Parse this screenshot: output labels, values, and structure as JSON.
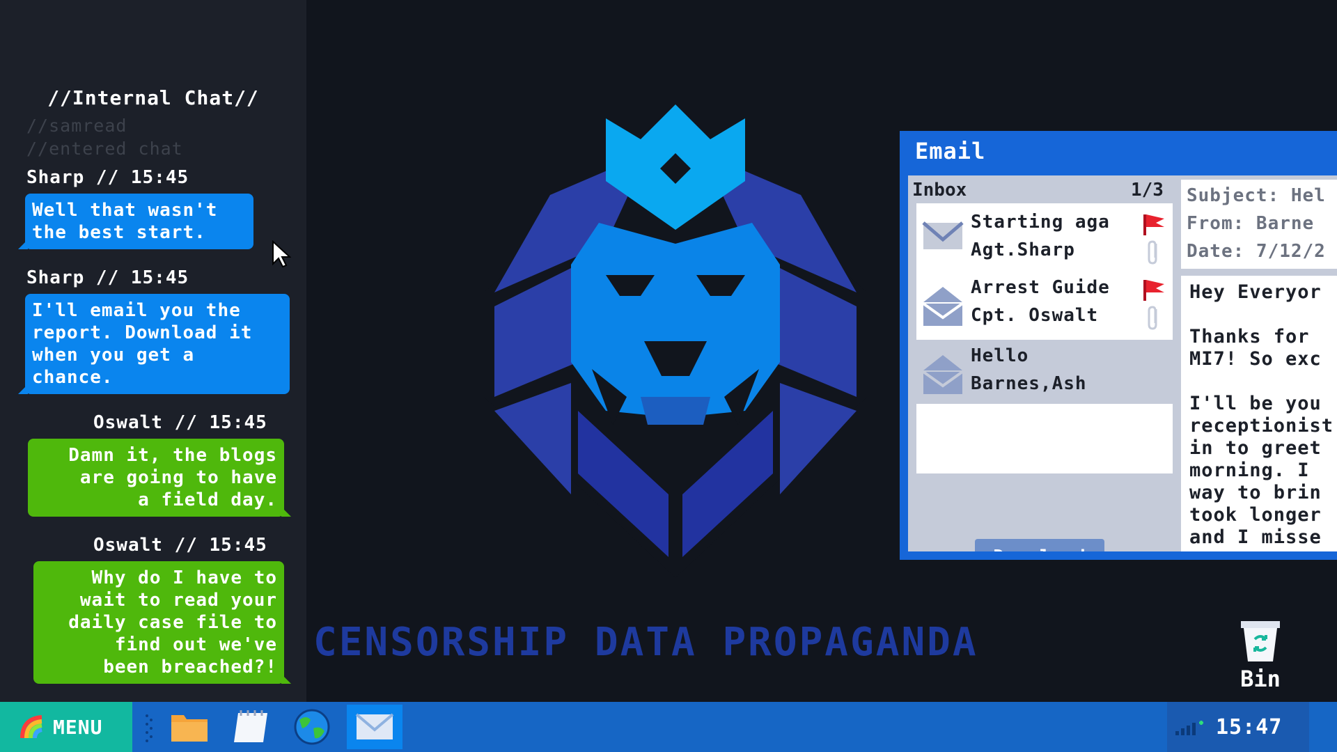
{
  "chat": {
    "title": "//Internal Chat//",
    "system": [
      "//samread",
      "//entered chat"
    ],
    "messages": [
      {
        "header": "Sharp // 15:45",
        "text": [
          "Well that wasn't",
          "the best start."
        ]
      },
      {
        "header": "Sharp // 15:45",
        "text": [
          "I'll email you the",
          "report. Download it",
          "when you get a",
          "chance."
        ]
      },
      {
        "header": "Oswalt // 15:45",
        "text": [
          "Damn it, the blogs",
          "are going to have",
          "a field day."
        ]
      },
      {
        "header": "Oswalt // 15:45",
        "text": [
          "Why do I have to",
          "wait to read your",
          "daily case file to",
          "find out we've",
          "been breached?!"
        ]
      }
    ]
  },
  "desktop": {
    "slogan": "CENSORSHIP DATA PROPAGANDA",
    "bin_label": "Bin"
  },
  "email": {
    "title": "Email",
    "inbox_label": "Inbox",
    "inbox_count": "1/3",
    "items": [
      {
        "subject": "Starting aga",
        "from": "Agt.Sharp"
      },
      {
        "subject": "Arrest Guide",
        "from": "Cpt. Oswalt"
      },
      {
        "subject": "Hello",
        "from": "Barnes,Ash"
      }
    ],
    "download_label": "Download",
    "reader": {
      "subject": "Subject: Hel",
      "from": "From: Barne",
      "date": "Date: 7/12/2",
      "body": [
        "Hey Everyor",
        "",
        "Thanks for",
        "MI7! So exc",
        "",
        "I'll be you",
        "receptionist",
        "in to greet",
        "morning. I",
        "way to brin",
        "took longer",
        "and I misse"
      ]
    }
  },
  "taskbar": {
    "menu_label": "MENU",
    "clock": "15:47"
  },
  "colors": {
    "chat_blue": "#0a85ee",
    "chat_green": "#4fb80c",
    "window_blue": "#1666d8",
    "taskbar_blue": "#1666c5",
    "menu_teal": "#12b8a0"
  }
}
